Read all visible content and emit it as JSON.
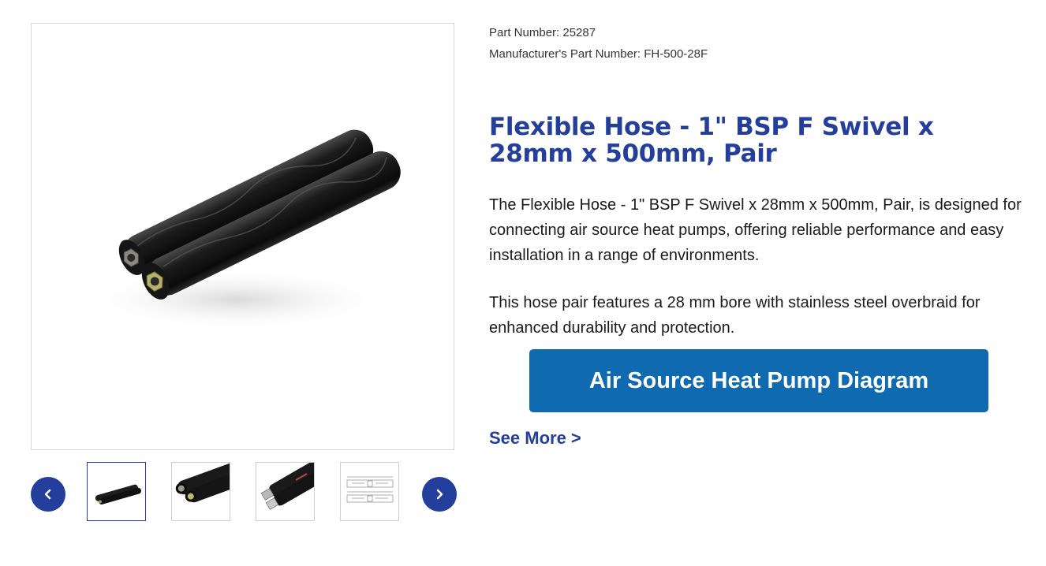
{
  "gallery": {
    "main_image_alt": "",
    "prev_icon": "chevron-left-icon",
    "next_icon": "chevron-right-icon",
    "thumbnails": [
      {
        "icon": "hose-pair-thumbnail",
        "active": true
      },
      {
        "icon": "hose-ends-thumbnail",
        "active": false
      },
      {
        "icon": "hose-fittings-thumbnail",
        "active": false
      },
      {
        "icon": "dimension-drawing-thumbnail",
        "active": false
      }
    ],
    "accent_color": "#243e9b"
  },
  "product": {
    "part_number": "Part Number: 25287",
    "manufacturer_part_number": "Manufacturer's Part Number: FH-500-28F",
    "title": "Flexible Hose - 1\" BSP F Swivel x 28mm x 500mm, Pair",
    "description_1": "The Flexible Hose - 1\" BSP F Swivel x 28mm x 500mm, Pair, is designed for connecting air source heat pumps, offering reliable performance and easy installation in a range of environments.",
    "description_2": "This hose pair features a 28 mm bore with stainless steel overbraid for enhanced durability and protection.",
    "diagram_button_label": "Air Source Heat Pump Diagram",
    "see_more_label": "See More >"
  },
  "colors": {
    "title": "#243e9b",
    "button": "#0f6ab0",
    "text": "#1a1a1a"
  }
}
